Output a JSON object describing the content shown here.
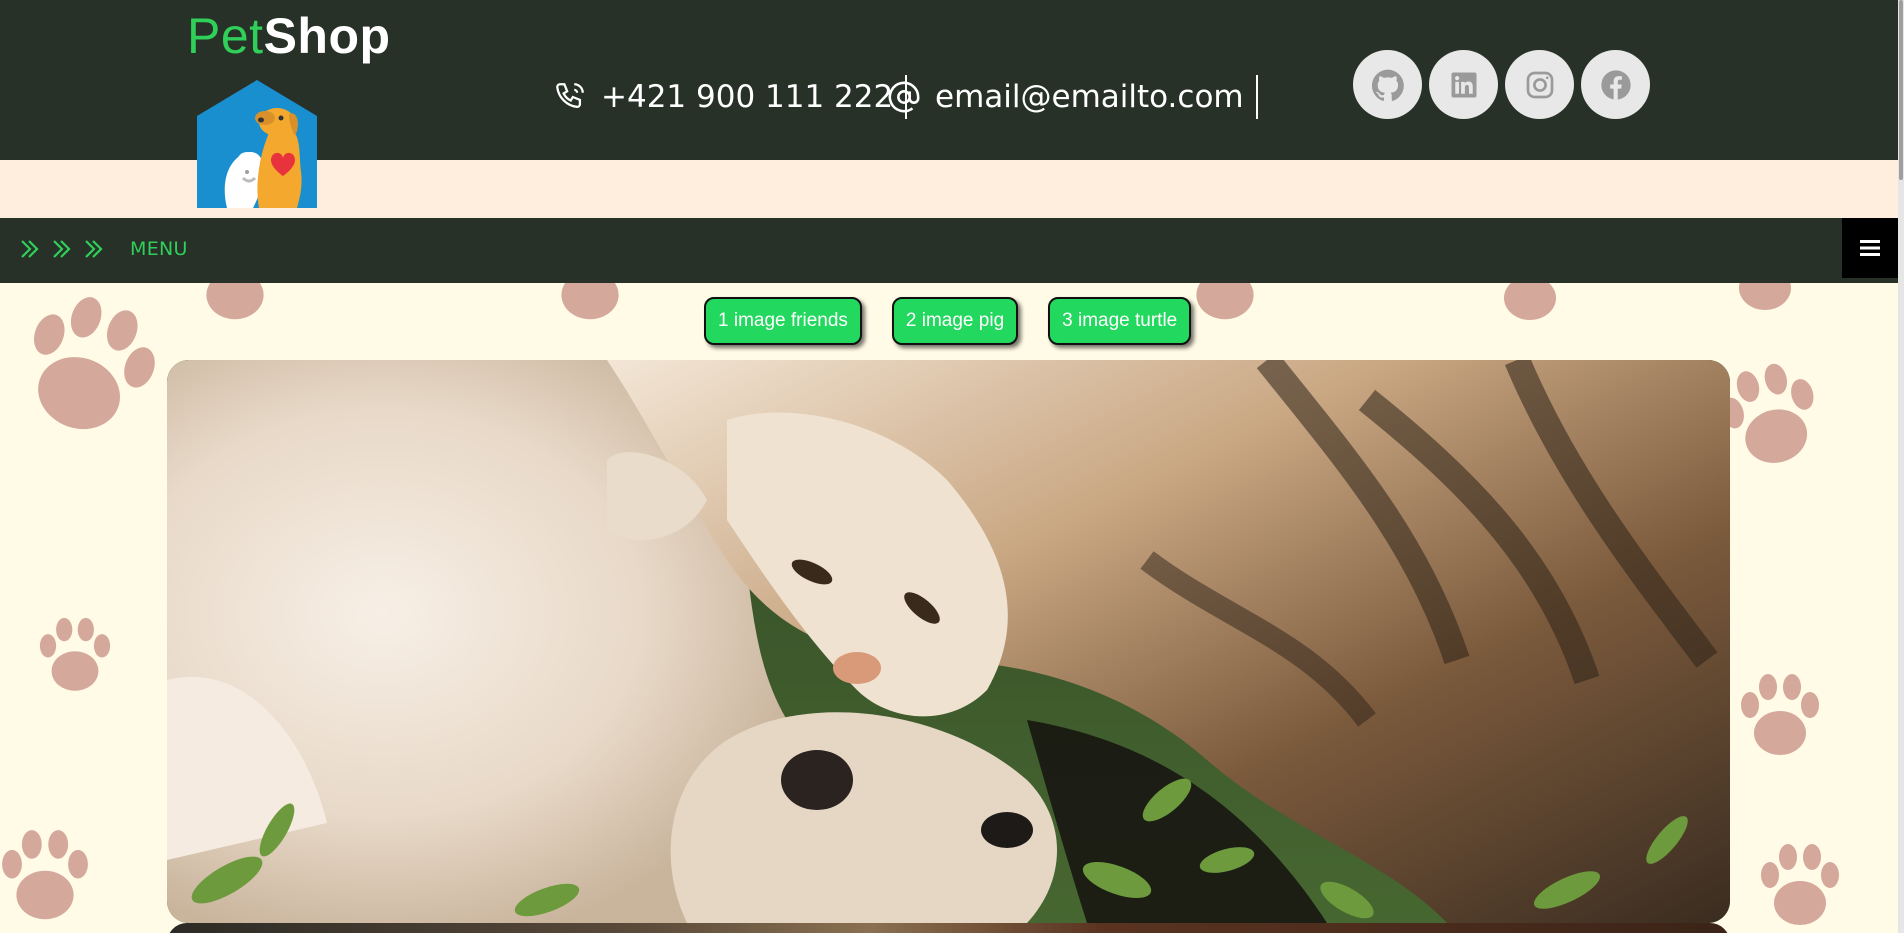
{
  "brand": {
    "part1": "Pet",
    "part2": "Shop",
    "logo_icon": "pet-house-logo"
  },
  "contact": {
    "phone": "+421 900 111 222",
    "email": "email@emailto.com",
    "phone_icon": "phone-icon",
    "email_icon": "at-icon"
  },
  "socials": [
    {
      "name": "github-icon"
    },
    {
      "name": "linkedin-icon"
    },
    {
      "name": "instagram-icon"
    },
    {
      "name": "facebook-icon"
    }
  ],
  "menu": {
    "label": "MENU",
    "toggle_icon": "hamburger-icon"
  },
  "gallery": {
    "buttons": [
      "1 image friends",
      "2 image pig",
      "3 image turtle"
    ],
    "photo": "cat-and-dog-photo"
  },
  "colors": {
    "header_bg": "#273128",
    "accent_green": "#2fcf5a",
    "button_green": "#22d85e",
    "band": "#ffeedd",
    "page_bg": "#fffbe6",
    "paw": "#d4a89a"
  }
}
